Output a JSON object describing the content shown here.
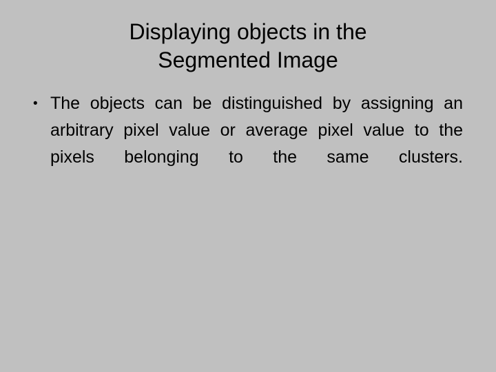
{
  "slide": {
    "background_color": "#c0c0c0",
    "text_color": "#000000",
    "title": {
      "line1": "Displaying objects in the",
      "line2": "Segmented Image",
      "full": "Displaying objects in the Segmented Image"
    },
    "body": {
      "bullets": [
        {
          "marker": "•",
          "text": "The objects can be distinguished by assigning an arbitrary pixel value or average pixel value to the pixels belonging to the same clusters."
        }
      ]
    }
  }
}
